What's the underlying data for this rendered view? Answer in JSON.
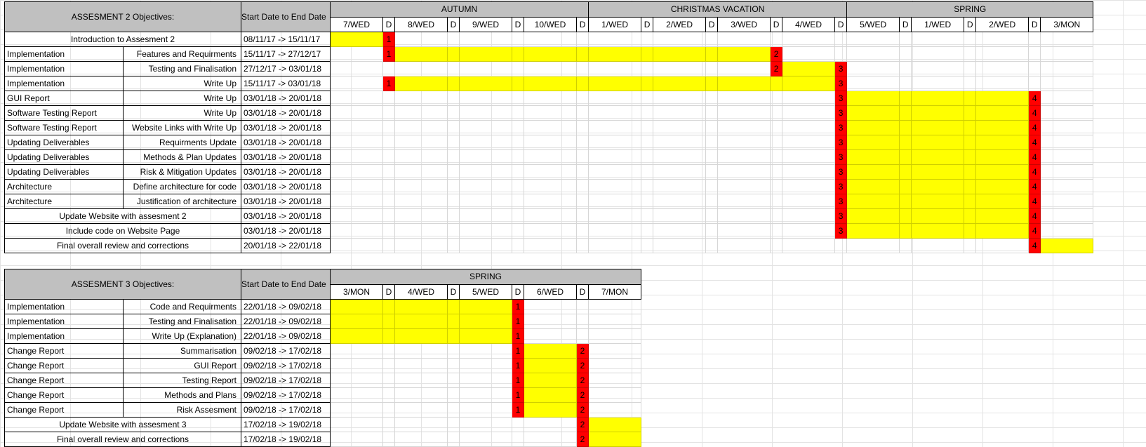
{
  "colors": {
    "bar": "#ffff00",
    "milestone": "#ff0000",
    "header": "#c0c0c0"
  },
  "a2": {
    "title": "ASSESMENT 2 Objectives:",
    "date_header": "Start Date to End Date",
    "seasons": [
      "AUTUMN",
      "CHRISTMAS VACATION",
      "SPRING"
    ],
    "columns": [
      "7/WED",
      "D",
      "8/WED",
      "D",
      "9/WED",
      "D",
      "10/WED",
      "D",
      "1/WED",
      "D",
      "2/WED",
      "D",
      "3/WED",
      "D",
      "4/WED",
      "D",
      "5/WED",
      "D",
      "1/WED",
      "D",
      "2/WED",
      "D",
      "3/MON"
    ],
    "rows": [
      {
        "a": "Introduction to Assesment 2",
        "b": "",
        "full": true,
        "date": "08/11/17 -> 15/11/17",
        "bar": [
          0
        ],
        "marks": [
          [
            1,
            "1"
          ]
        ]
      },
      {
        "a": "Implementation",
        "b": "Features and Requirments",
        "date": "15/11/17 -> 27/12/17",
        "bar": [
          2,
          3,
          4,
          5,
          6,
          7,
          8,
          9,
          10,
          11,
          12
        ],
        "marks": [
          [
            1,
            "1"
          ],
          [
            13,
            "2"
          ]
        ]
      },
      {
        "a": "Implementation",
        "b": "Testing and Finalisation",
        "date": "27/12/17 -> 03/01/18",
        "bar": [
          14
        ],
        "marks": [
          [
            13,
            "2"
          ],
          [
            15,
            "3"
          ]
        ]
      },
      {
        "a": "Implementation",
        "b": "Write Up",
        "date": "15/11/17 -> 03/01/18",
        "bar": [
          2,
          3,
          4,
          5,
          6,
          7,
          8,
          9,
          10,
          11,
          12,
          13,
          14
        ],
        "marks": [
          [
            1,
            "1"
          ],
          [
            15,
            "3"
          ]
        ]
      },
      {
        "a": "GUI Report",
        "b": "Write Up",
        "date": "03/01/18 -> 20/01/18",
        "bar": [
          16,
          17,
          18,
          19,
          20
        ],
        "marks": [
          [
            15,
            "3"
          ],
          [
            21,
            "4"
          ]
        ]
      },
      {
        "a": "Software Testing Report",
        "b": "Write Up",
        "date": "03/01/18 -> 20/01/18",
        "bar": [
          16,
          17,
          18,
          19,
          20
        ],
        "marks": [
          [
            15,
            "3"
          ],
          [
            21,
            "4"
          ]
        ]
      },
      {
        "a": "Software Testing Report",
        "b": "Website Links with Write Up",
        "date": "03/01/18 -> 20/01/18",
        "bar": [
          16,
          17,
          18,
          19,
          20
        ],
        "marks": [
          [
            15,
            "3"
          ],
          [
            21,
            "4"
          ]
        ]
      },
      {
        "a": "Updating Deliverables",
        "b": "Requirments Update",
        "date": "03/01/18 -> 20/01/18",
        "bar": [
          16,
          17,
          18,
          19,
          20
        ],
        "marks": [
          [
            15,
            "3"
          ],
          [
            21,
            "4"
          ]
        ]
      },
      {
        "a": "Updating Deliverables",
        "b": "Methods & Plan Updates",
        "date": "03/01/18 -> 20/01/18",
        "bar": [
          16,
          17,
          18,
          19,
          20
        ],
        "marks": [
          [
            15,
            "3"
          ],
          [
            21,
            "4"
          ]
        ]
      },
      {
        "a": "Updating Deliverables",
        "b": "Risk & Mitigation Updates",
        "date": "03/01/18 -> 20/01/18",
        "bar": [
          16,
          17,
          18,
          19,
          20
        ],
        "marks": [
          [
            15,
            "3"
          ],
          [
            21,
            "4"
          ]
        ]
      },
      {
        "a": "Architecture",
        "b": "Define architecture for code",
        "date": "03/01/18 -> 20/01/18",
        "bar": [
          16,
          17,
          18,
          19,
          20
        ],
        "marks": [
          [
            15,
            "3"
          ],
          [
            21,
            "4"
          ]
        ]
      },
      {
        "a": "Architecture",
        "b": "Justification of architecture",
        "date": "03/01/18 -> 20/01/18",
        "bar": [
          16,
          17,
          18,
          19,
          20
        ],
        "marks": [
          [
            15,
            "3"
          ],
          [
            21,
            "4"
          ]
        ]
      },
      {
        "a": "Update Website with assesment 2",
        "b": "",
        "full": true,
        "date": "03/01/18 -> 20/01/18",
        "bar": [
          16,
          17,
          18,
          19,
          20
        ],
        "marks": [
          [
            15,
            "3"
          ],
          [
            21,
            "4"
          ]
        ]
      },
      {
        "a": "Include code on Website Page",
        "b": "",
        "full": true,
        "date": "03/01/18 -> 20/01/18",
        "bar": [
          16,
          17,
          18,
          19,
          20
        ],
        "marks": [
          [
            15,
            "3"
          ],
          [
            21,
            "4"
          ]
        ]
      },
      {
        "a": "Final overall review and corrections",
        "b": "",
        "full": true,
        "date": "20/01/18 -> 22/01/18",
        "bar": [
          22
        ],
        "marks": [
          [
            21,
            "4"
          ]
        ]
      }
    ]
  },
  "a3": {
    "title": "ASSESMENT 3 Objectives:",
    "date_header": "Start Date to End Date",
    "seasons": [
      "SPRING"
    ],
    "columns": [
      "3/MON",
      "D",
      "4/WED",
      "D",
      "5/WED",
      "D",
      "6/WED",
      "D",
      "7/MON"
    ],
    "rows": [
      {
        "a": "Implementation",
        "b": "Code and Requirments",
        "date": "22/01/18 -> 09/02/18",
        "bar": [
          0,
          1,
          2,
          3,
          4
        ],
        "marks": [
          [
            5,
            "1"
          ]
        ]
      },
      {
        "a": "Implementation",
        "b": "Testing and Finalisation",
        "date": "22/01/18 -> 09/02/18",
        "bar": [
          0,
          1,
          2,
          3,
          4
        ],
        "marks": [
          [
            5,
            "1"
          ]
        ]
      },
      {
        "a": "Implementation",
        "b": "Write Up (Explanation)",
        "date": "22/01/18 -> 09/02/18",
        "bar": [
          0,
          1,
          2,
          3,
          4
        ],
        "marks": [
          [
            5,
            "1"
          ]
        ]
      },
      {
        "a": "Change Report",
        "b": "Summarisation",
        "date": "09/02/18 -> 17/02/18",
        "bar": [
          6
        ],
        "marks": [
          [
            5,
            "1"
          ],
          [
            7,
            "2"
          ]
        ]
      },
      {
        "a": "Change Report",
        "b": "GUI Report",
        "date": "09/02/18 -> 17/02/18",
        "bar": [
          6
        ],
        "marks": [
          [
            5,
            "1"
          ],
          [
            7,
            "2"
          ]
        ]
      },
      {
        "a": "Change Report",
        "b": "Testing Report",
        "date": "09/02/18 -> 17/02/18",
        "bar": [
          6
        ],
        "marks": [
          [
            5,
            "1"
          ],
          [
            7,
            "2"
          ]
        ]
      },
      {
        "a": "Change Report",
        "b": "Methods and Plans",
        "date": "09/02/18 -> 17/02/18",
        "bar": [
          6
        ],
        "marks": [
          [
            5,
            "1"
          ],
          [
            7,
            "2"
          ]
        ]
      },
      {
        "a": "Change Report",
        "b": "Risk Assesment",
        "date": "09/02/18 -> 17/02/18",
        "bar": [
          6
        ],
        "marks": [
          [
            5,
            "1"
          ],
          [
            7,
            "2"
          ]
        ]
      },
      {
        "a": "Update Website with assesment 3",
        "b": "",
        "full": true,
        "date": "17/02/18 -> 19/02/18",
        "bar": [
          8
        ],
        "marks": [
          [
            7,
            "2"
          ]
        ]
      },
      {
        "a": "Final overall review and corrections",
        "b": "",
        "full": true,
        "date": "17/02/18 -> 19/02/18",
        "bar": [
          8
        ],
        "marks": [
          [
            7,
            "2"
          ]
        ]
      }
    ]
  }
}
